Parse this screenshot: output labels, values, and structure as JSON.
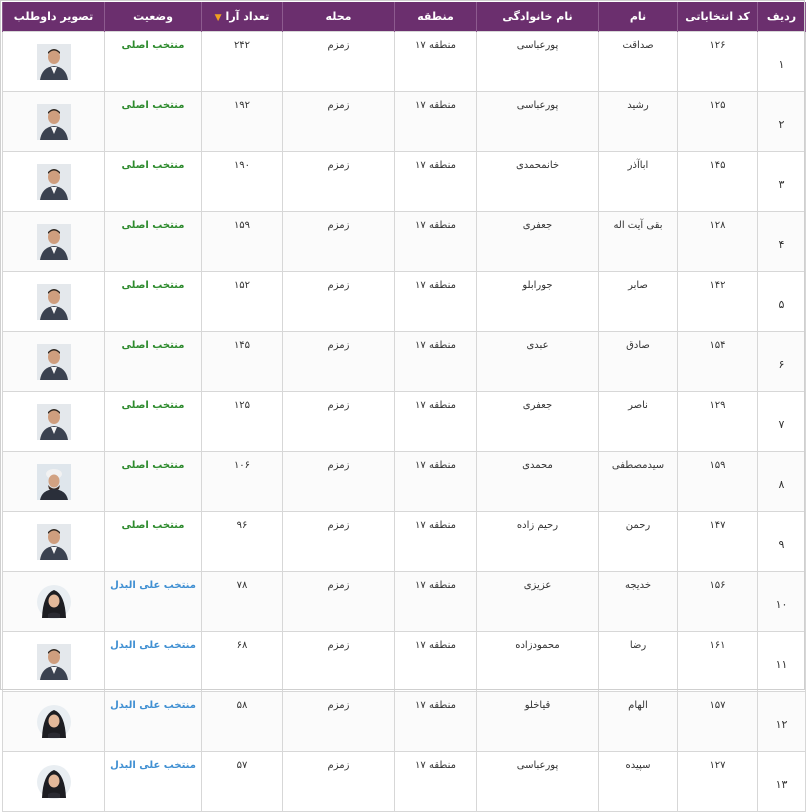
{
  "headers": {
    "row": "ردیف",
    "code": "کد انتخاباتی",
    "first": "نام",
    "last": "نام خانوادگی",
    "zone": "منطقه",
    "area": "محله",
    "votes": "تعداد آرا",
    "status": "وضعیت",
    "photo": "تصویر داوطلب"
  },
  "sort_indicator": "▼",
  "colors": {
    "header_bg": "#6b2f6e",
    "main_status": "#2e8b2e",
    "alt_status": "#3f8fd2",
    "sort_arrow": "#f0a020"
  },
  "rows": [
    {
      "row": "۱",
      "code": "۱۲۶",
      "first": "صداقت",
      "last": "پورعباسی",
      "zone": "منطقه ۱۷",
      "area": "زمزم",
      "votes": "۲۴۲",
      "status": "منتخب اصلی",
      "status_type": "main",
      "photo": "male-candidate-photo"
    },
    {
      "row": "۲",
      "code": "۱۲۵",
      "first": "رشید",
      "last": "پورعباسی",
      "zone": "منطقه ۱۷",
      "area": "زمزم",
      "votes": "۱۹۲",
      "status": "منتخب اصلی",
      "status_type": "main",
      "photo": "male-candidate-photo"
    },
    {
      "row": "۳",
      "code": "۱۴۵",
      "first": "اباآذر",
      "last": "خانمحمدی",
      "zone": "منطقه ۱۷",
      "area": "زمزم",
      "votes": "۱۹۰",
      "status": "منتخب اصلی",
      "status_type": "main",
      "photo": "male-candidate-photo"
    },
    {
      "row": "۴",
      "code": "۱۲۸",
      "first": "بقی آیت اله",
      "last": "جعفری",
      "zone": "منطقه ۱۷",
      "area": "زمزم",
      "votes": "۱۵۹",
      "status": "منتخب اصلی",
      "status_type": "main",
      "photo": "male-candidate-photo"
    },
    {
      "row": "۵",
      "code": "۱۴۲",
      "first": "صابر",
      "last": "جورابلو",
      "zone": "منطقه ۱۷",
      "area": "زمزم",
      "votes": "۱۵۲",
      "status": "منتخب اصلی",
      "status_type": "main",
      "photo": "male-candidate-photo"
    },
    {
      "row": "۶",
      "code": "۱۵۴",
      "first": "صادق",
      "last": "عبدی",
      "zone": "منطقه ۱۷",
      "area": "زمزم",
      "votes": "۱۴۵",
      "status": "منتخب اصلی",
      "status_type": "main",
      "photo": "male-candidate-photo"
    },
    {
      "row": "۷",
      "code": "۱۲۹",
      "first": "ناصر",
      "last": "جعفری",
      "zone": "منطقه ۱۷",
      "area": "زمزم",
      "votes": "۱۲۵",
      "status": "منتخب اصلی",
      "status_type": "main",
      "photo": "male-candidate-photo"
    },
    {
      "row": "۸",
      "code": "۱۵۹",
      "first": "سیدمصطفی",
      "last": "محمدی",
      "zone": "منطقه ۱۷",
      "area": "زمزم",
      "votes": "۱۰۶",
      "status": "منتخب اصلی",
      "status_type": "main",
      "photo": "cleric-candidate-photo"
    },
    {
      "row": "۹",
      "code": "۱۴۷",
      "first": "رحمن",
      "last": "رحیم زاده",
      "zone": "منطقه ۱۷",
      "area": "زمزم",
      "votes": "۹۶",
      "status": "منتخب اصلی",
      "status_type": "main",
      "photo": "male-candidate-photo"
    },
    {
      "row": "۱۰",
      "code": "۱۵۶",
      "first": "خدیجه",
      "last": "عزیزی",
      "zone": "منطقه ۱۷",
      "area": "زمزم",
      "votes": "۷۸",
      "status": "منتخب علی البدل",
      "status_type": "alt",
      "photo": "female-candidate-photo"
    },
    {
      "row": "۱۱",
      "code": "۱۶۱",
      "first": "رضا",
      "last": "محمودزاده",
      "zone": "منطقه ۱۷",
      "area": "زمزم",
      "votes": "۶۸",
      "status": "منتخب علی البدل",
      "status_type": "alt",
      "photo": "male-candidate-photo"
    },
    {
      "row": "۱۲",
      "code": "۱۵۷",
      "first": "الهام",
      "last": "قیاخلو",
      "zone": "منطقه ۱۷",
      "area": "زمزم",
      "votes": "۵۸",
      "status": "منتخب علی البدل",
      "status_type": "alt",
      "photo": "female-candidate-photo"
    },
    {
      "row": "۱۳",
      "code": "۱۲۷",
      "first": "سپیده",
      "last": "پورعباسی",
      "zone": "منطقه ۱۷",
      "area": "زمزم",
      "votes": "۵۷",
      "status": "منتخب علی البدل",
      "status_type": "alt",
      "photo": "female-candidate-photo"
    }
  ]
}
